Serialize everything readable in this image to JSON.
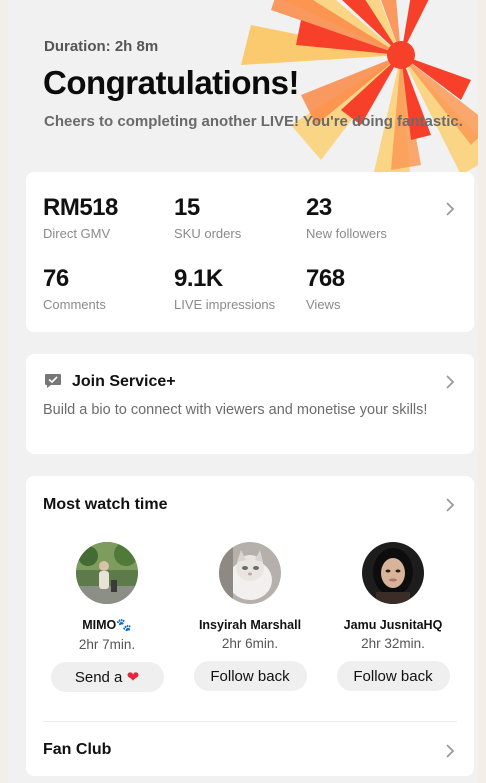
{
  "header": {
    "duration": "Duration: 2h 8m",
    "title": "Congratulations!",
    "subtitle": "Cheers to completing another LIVE! You're doing fantastic."
  },
  "stats": [
    {
      "value": "RM518",
      "label": "Direct GMV"
    },
    {
      "value": "15",
      "label": "SKU orders"
    },
    {
      "value": "23",
      "label": "New followers"
    },
    {
      "value": "76",
      "label": "Comments"
    },
    {
      "value": "9.1K",
      "label": "LIVE impressions"
    },
    {
      "value": "768",
      "label": "Views"
    }
  ],
  "service": {
    "title": "Join Service+",
    "description": "Build a bio to connect with viewers and monetise your skills!"
  },
  "watch": {
    "title": "Most watch time",
    "viewers": [
      {
        "name": "MIMO🐾",
        "time": "2hr 7min.",
        "action": "Send a",
        "icon": "heart-icon"
      },
      {
        "name": "Insyirah Marshall",
        "time": "2hr 6min.",
        "action": "Follow back"
      },
      {
        "name": "Jamu JusnitaHQ",
        "time": "2hr 32min.",
        "action": "Follow back"
      }
    ]
  },
  "fan_club": {
    "title": "Fan Club"
  },
  "icons": {
    "chevron": "chevron-right-icon",
    "service": "chat-bubble-icon"
  },
  "colors": {
    "burst_red": "#f7402a",
    "burst_orange": "#fa8a45",
    "burst_yellow": "#fcc560",
    "heart": "#e5273c"
  }
}
